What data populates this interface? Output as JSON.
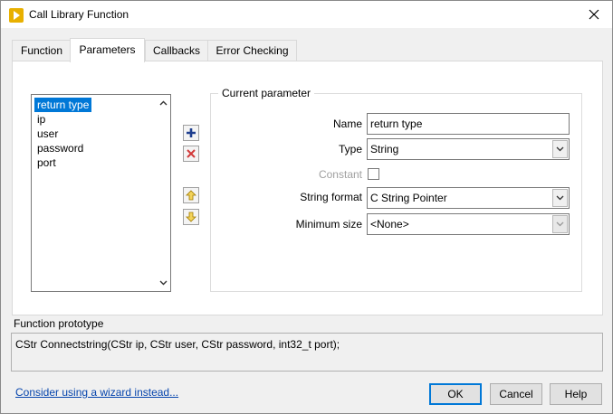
{
  "window": {
    "title": "Call Library Function",
    "app_icon": "labview-run-arrow-icon",
    "close_icon": "close-icon"
  },
  "tabs": [
    {
      "label": "Function",
      "active": false
    },
    {
      "label": "Parameters",
      "active": true
    },
    {
      "label": "Callbacks",
      "active": false
    },
    {
      "label": "Error Checking",
      "active": false
    }
  ],
  "parameters_list": {
    "items": [
      "return type",
      "ip",
      "user",
      "password",
      "port"
    ],
    "selected": "return type"
  },
  "list_buttons": {
    "add": "add-parameter-icon",
    "delete": "delete-parameter-icon",
    "move_up": "move-up-icon",
    "move_down": "move-down-icon"
  },
  "current_parameter": {
    "group_title": "Current parameter",
    "name_label": "Name",
    "name_value": "return type",
    "type_label": "Type",
    "type_value": "String",
    "constant_label": "Constant",
    "constant_checked": false,
    "string_format_label": "String format",
    "string_format_value": "C String Pointer",
    "minimum_size_label": "Minimum size",
    "minimum_size_value": "<None>"
  },
  "prototype": {
    "label": "Function prototype",
    "text": "CStr Connectstring(CStr ip, CStr user, CStr password, int32_t port);"
  },
  "footer": {
    "wizard_link": "Consider using a wizard instead...",
    "ok_label": "OK",
    "cancel_label": "Cancel",
    "help_label": "Help"
  },
  "colors": {
    "selection": "#0078d7",
    "add_icon": "#1f3f8f",
    "delete_icon": "#d23a3a",
    "arrow_icon": "#e8c23a",
    "title_icon": "#e8b000"
  }
}
